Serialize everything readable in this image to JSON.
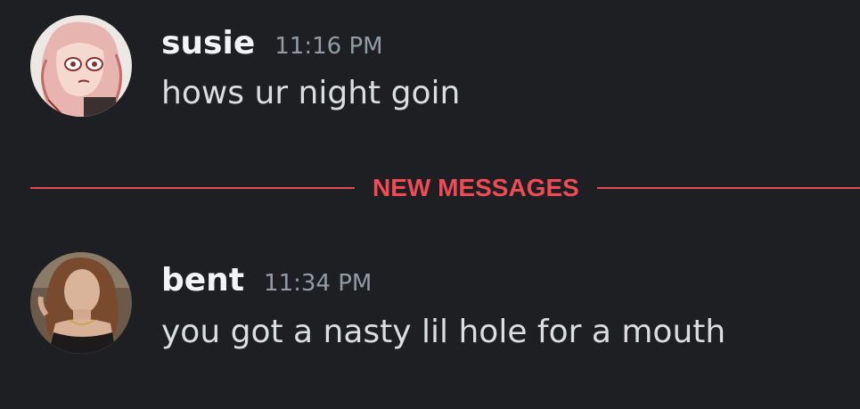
{
  "messages": [
    {
      "username": "susie",
      "timestamp": "11:16 PM",
      "content": "hows ur night goin",
      "avatar": "drawn-character-avatar"
    },
    {
      "username": "bent",
      "timestamp": "11:34 PM",
      "content": "you got a nasty lil hole for a mouth",
      "avatar": "photo-avatar"
    }
  ],
  "divider": {
    "label": "NEW MESSAGES"
  },
  "colors": {
    "background": "#1e1f22",
    "username": "#f2f3f5",
    "timestamp": "#949ba4",
    "text": "#dbdee1",
    "new_messages": "#e04c55"
  }
}
